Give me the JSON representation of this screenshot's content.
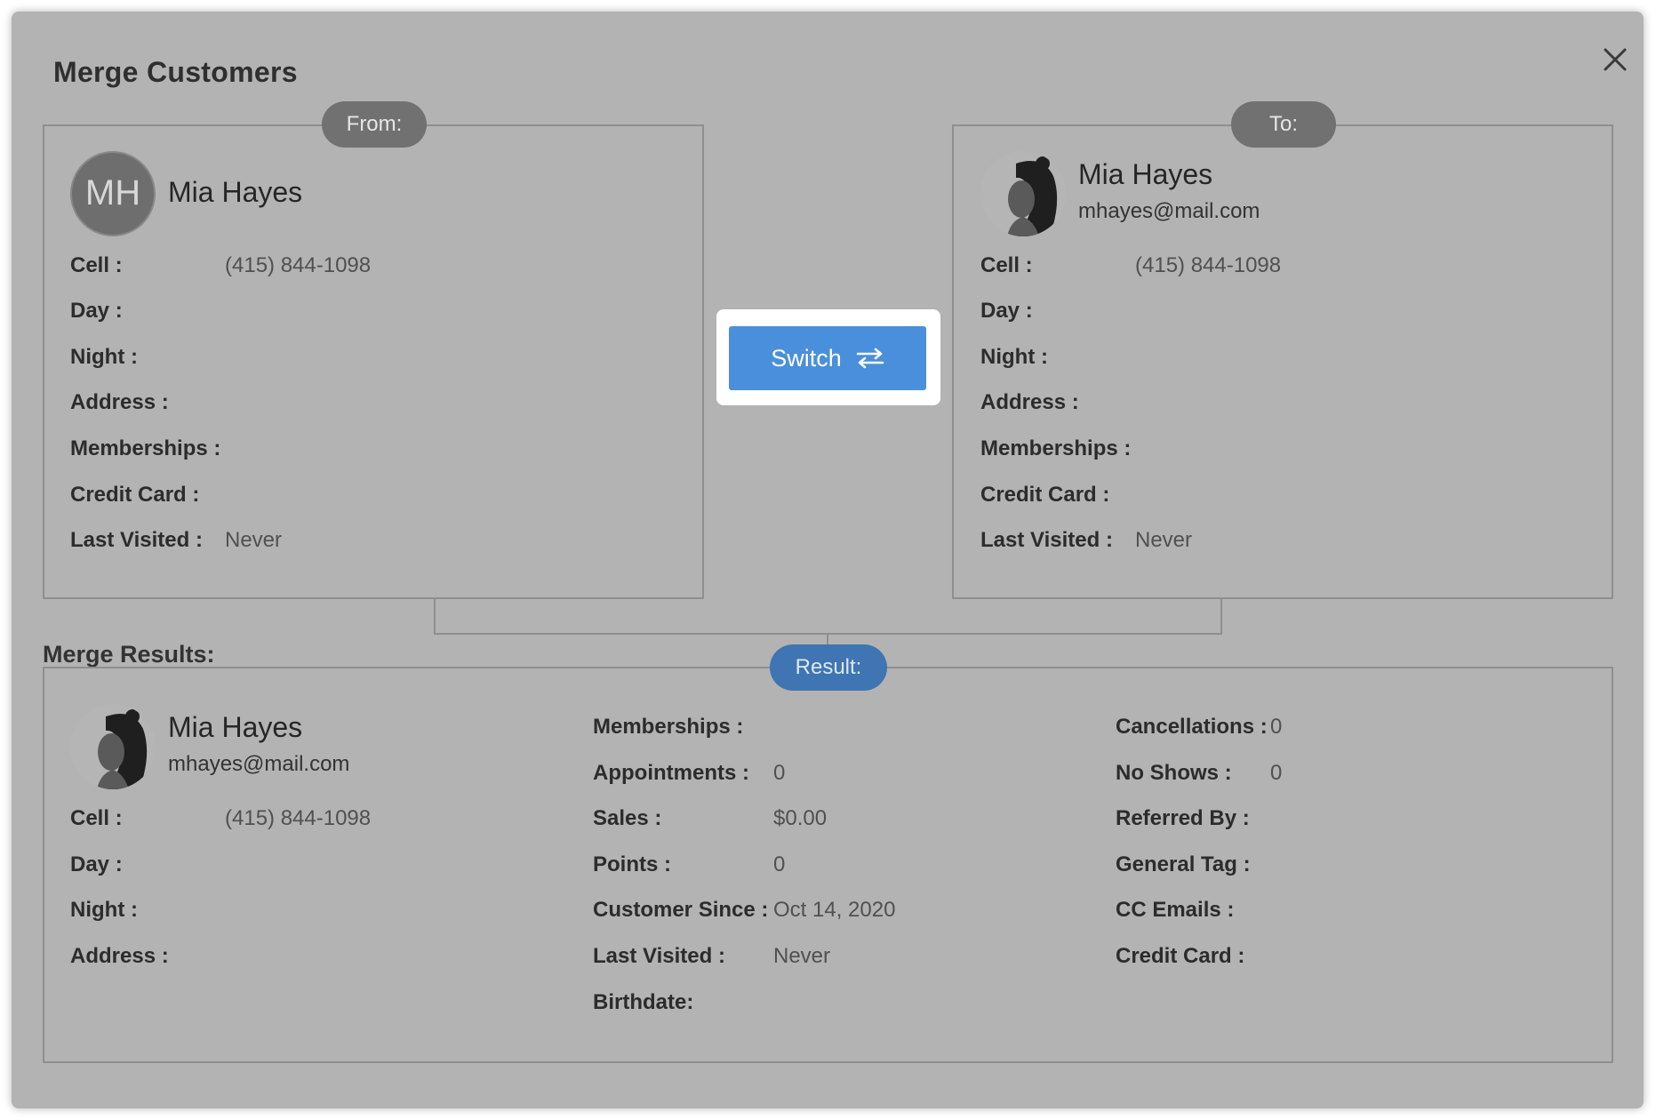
{
  "dialog": {
    "title": "Merge Customers",
    "close_icon": "close-icon"
  },
  "from": {
    "badge": "From:",
    "initials": "MH",
    "name": "Mia Hayes",
    "fields": [
      {
        "label": "Cell :",
        "value": "(415) 844-1098"
      },
      {
        "label": "Day :",
        "value": ""
      },
      {
        "label": "Night :",
        "value": ""
      },
      {
        "label": "Address :",
        "value": ""
      },
      {
        "label": "Memberships :",
        "value": ""
      },
      {
        "label": "Credit Card :",
        "value": ""
      },
      {
        "label": "Last Visited :",
        "value": "Never"
      }
    ]
  },
  "to": {
    "badge": "To:",
    "name": "Mia Hayes",
    "email": "mhayes@mail.com",
    "fields": [
      {
        "label": "Cell :",
        "value": "(415) 844-1098"
      },
      {
        "label": "Day :",
        "value": ""
      },
      {
        "label": "Night :",
        "value": ""
      },
      {
        "label": "Address :",
        "value": ""
      },
      {
        "label": "Memberships :",
        "value": ""
      },
      {
        "label": "Credit Card :",
        "value": ""
      },
      {
        "label": "Last Visited :",
        "value": "Never"
      }
    ]
  },
  "switch": {
    "label": "Switch",
    "icon": "swap-arrows-icon",
    "color": "#4a8fdb"
  },
  "results": {
    "section_title": "Merge Results:",
    "badge": "Result:",
    "name": "Mia Hayes",
    "email": "mhayes@mail.com",
    "col1": [
      {
        "label": "Cell :",
        "value": "(415) 844-1098"
      },
      {
        "label": "Day :",
        "value": ""
      },
      {
        "label": "Night :",
        "value": ""
      },
      {
        "label": "Address :",
        "value": ""
      }
    ],
    "col2": [
      {
        "label": "Memberships :",
        "value": ""
      },
      {
        "label": "Appointments :",
        "value": "0"
      },
      {
        "label": "Sales :",
        "value": "$0.00"
      },
      {
        "label": "Points :",
        "value": "0"
      },
      {
        "label": "Customer Since :",
        "value": "Oct 14, 2020"
      },
      {
        "label": "Last Visited :",
        "value": "Never"
      },
      {
        "label": "Birthdate:",
        "value": ""
      }
    ],
    "col3": [
      {
        "label": "Cancellations :",
        "value": "0"
      },
      {
        "label": "No Shows :",
        "value": "0"
      },
      {
        "label": "Referred By :",
        "value": ""
      },
      {
        "label": "General Tag :",
        "value": ""
      },
      {
        "label": "CC Emails :",
        "value": ""
      },
      {
        "label": "Credit Card :",
        "value": ""
      }
    ]
  }
}
